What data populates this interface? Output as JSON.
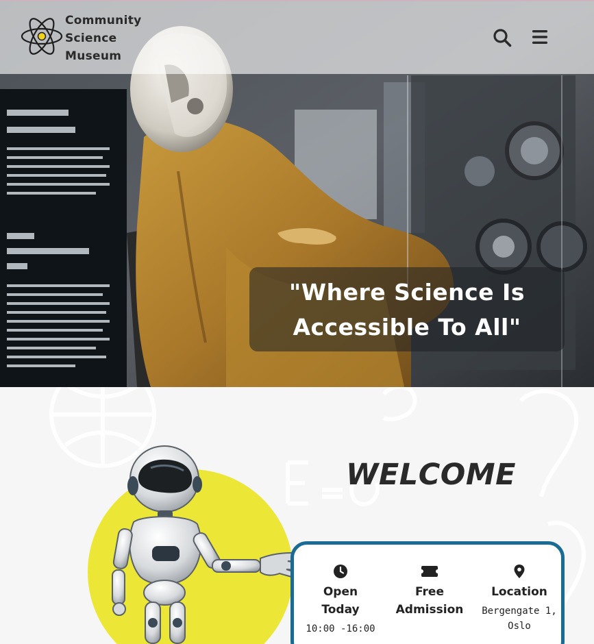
{
  "header": {
    "brand_line1": "Community",
    "brand_line2": "Science",
    "brand_line3": "Museum",
    "logo_icon": "atom-icon",
    "search_icon": "search-icon",
    "menu_icon": "hamburger-menu-icon"
  },
  "hero": {
    "quote_line1": "\"Where Science Is",
    "quote_line2": "Accessible To All\""
  },
  "welcome": {
    "title": "WELCOME",
    "info": [
      {
        "icon": "clock-icon",
        "heading_line1": "Open",
        "heading_line2": "Today",
        "detail": "10:00 -16:00"
      },
      {
        "icon": "ticket-icon",
        "heading_line1": "Free",
        "heading_line2": "Admission",
        "detail": ""
      },
      {
        "icon": "location-pin-icon",
        "heading_line1": "Location",
        "heading_line2": "",
        "detail_line1": "Bergengate 1,",
        "detail_line2": "Oslo"
      }
    ]
  },
  "colors": {
    "accent_blue": "#1a6c95",
    "circle_yellow": "#ece637",
    "nav_overlay": "rgba(255,255,255,0.62)"
  }
}
